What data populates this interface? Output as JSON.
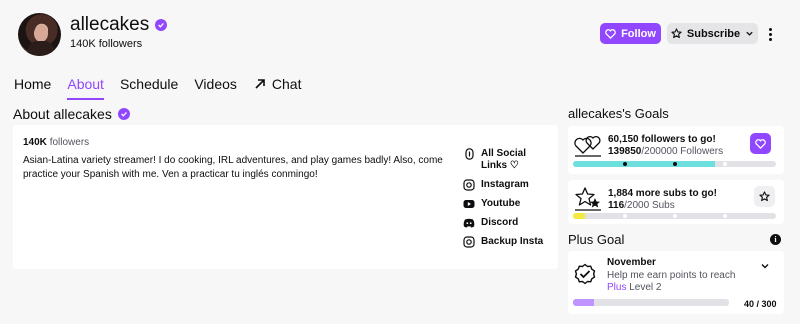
{
  "channel": {
    "name": "allecakes",
    "followers": "140K followers"
  },
  "actions": {
    "follow_label": "Follow",
    "subscribe_label": "Subscribe"
  },
  "tabs": [
    {
      "label": "Home"
    },
    {
      "label": "About",
      "active": true
    },
    {
      "label": "Schedule"
    },
    {
      "label": "Videos"
    },
    {
      "label": "Chat"
    }
  ],
  "about": {
    "title": "About allecakes",
    "followers_num": "140K",
    "followers_word": "followers",
    "bio": "Asian-Latina variety streamer! I do cooking, IRL adventures, and play games badly! Also, come practice your Spanish with me. Ven a practicar tu inglés conmingo!",
    "links": [
      {
        "label": "All Social Links ♡",
        "icon": "link-icon"
      },
      {
        "label": "Instagram",
        "icon": "instagram-icon"
      },
      {
        "label": "Youtube",
        "icon": "youtube-icon"
      },
      {
        "label": "Discord",
        "icon": "discord-icon"
      },
      {
        "label": "Backup Insta",
        "icon": "instagram-icon"
      }
    ]
  },
  "goals": {
    "title": "allecakes's Goals",
    "items": [
      {
        "headline": "60,150 followers to go!",
        "current": "139850",
        "target": "/200000 Followers",
        "progress": 0.7,
        "color": "#6de0de"
      },
      {
        "headline": "1,884 more subs to go!",
        "current": "116",
        "target": "/2000 Subs",
        "progress": 0.058,
        "color": "#f4ea3f"
      }
    ]
  },
  "plus_goal": {
    "title": "Plus Goal",
    "month": "November",
    "desc": "Help me earn points to reach",
    "level_prefix": "Plus",
    "level_suffix": " Level 2",
    "count": "40 / 300",
    "progress": 0.133
  },
  "colors": {
    "accent": "#9147ff",
    "background": "#f7f7f8"
  }
}
